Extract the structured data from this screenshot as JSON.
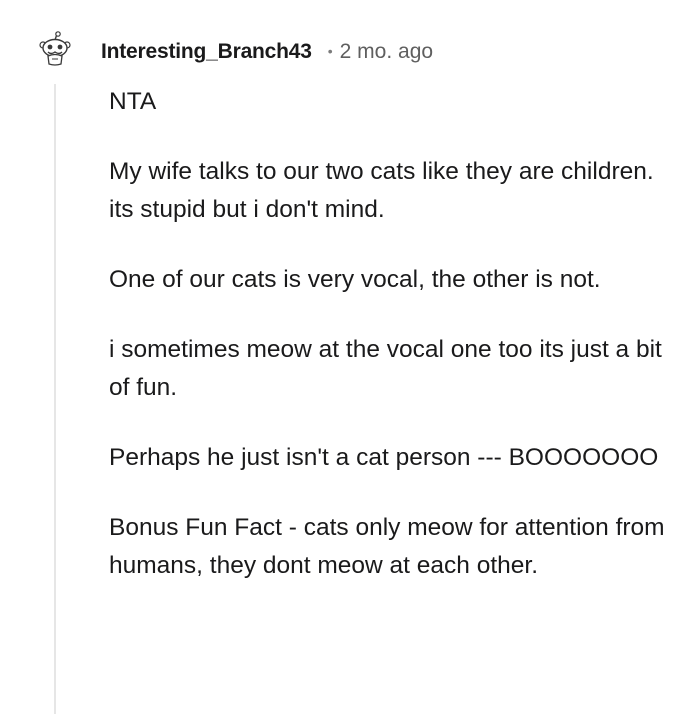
{
  "comment": {
    "author": "Interesting_Branch43",
    "separator": "•",
    "timestamp": "2 mo. ago",
    "avatar_icon": "snoo-avatar-icon",
    "paragraphs": [
      "NTA",
      "My wife talks to our two cats like they are children. its stupid but i don't mind.",
      "One of our cats is very vocal, the other is not.",
      "i sometimes meow at the vocal one too its just a bit of fun.",
      "Perhaps he just isn't a cat person --- BOOOOOOO",
      "Bonus Fun Fact - cats only meow for attention from humans, they dont meow at each other."
    ]
  }
}
